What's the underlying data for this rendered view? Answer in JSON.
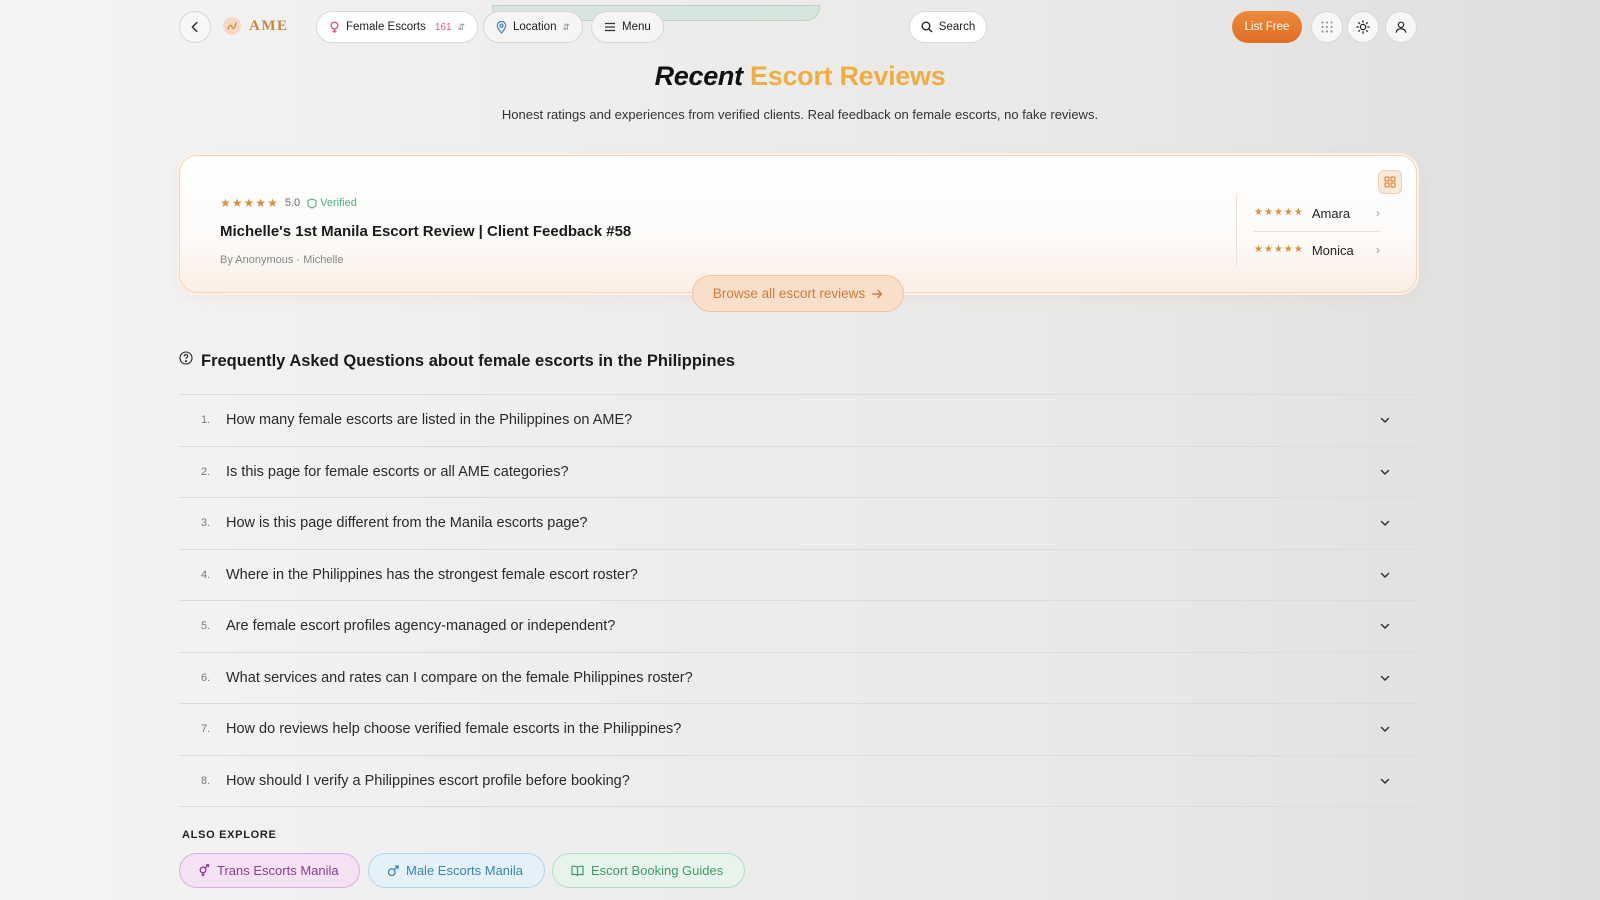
{
  "header": {
    "logo_text": "AME",
    "category_pill": {
      "label": "Female Escorts",
      "count": "161"
    },
    "location_pill": {
      "label": "Location"
    },
    "menu_pill": {
      "label": "Menu"
    },
    "search_label": "Search",
    "list_free_label": "List Free"
  },
  "hero": {
    "title_a": "Recent",
    "title_b": "Escort Reviews",
    "subtitle": "Honest ratings and experiences from verified clients. Real feedback on female escorts, no fake reviews."
  },
  "review_card": {
    "stars": 5,
    "rating": "5.0",
    "verified_label": "Verified",
    "title": "Michelle's 1st Manila Escort Review | Client Feedback #58",
    "byline": "By Anonymous · Michelle",
    "side_reviews": [
      {
        "name": "Amara",
        "stars": 5
      },
      {
        "name": "Monica",
        "stars": 5
      }
    ],
    "browse_label": "Browse all escort reviews"
  },
  "faq": {
    "heading": "Frequently Asked Questions about female escorts in the Philippines",
    "items": [
      {
        "num": "1.",
        "q": "How many female escorts are listed in the Philippines on AME?"
      },
      {
        "num": "2.",
        "q": "Is this page for female escorts or all AME categories?"
      },
      {
        "num": "3.",
        "q": "How is this page different from the Manila escorts page?"
      },
      {
        "num": "4.",
        "q": "Where in the Philippines has the strongest female escort roster?"
      },
      {
        "num": "5.",
        "q": "Are female escort profiles agency-managed or independent?"
      },
      {
        "num": "6.",
        "q": "What services and rates can I compare on the female Philippines roster?"
      },
      {
        "num": "7.",
        "q": "How do reviews help choose verified female escorts in the Philippines?"
      },
      {
        "num": "8.",
        "q": "How should I verify a Philippines escort profile before booking?"
      }
    ]
  },
  "also_explore": {
    "heading": "ALSO EXPLORE",
    "chips": [
      {
        "label": "Trans Escorts Manila",
        "icon": "transgender-icon"
      },
      {
        "label": "Male Escorts Manila",
        "icon": "male-icon"
      },
      {
        "label": "Escort Booking Guides",
        "icon": "book-icon"
      }
    ]
  },
  "colors": {
    "accent_orange": "#e07a2e",
    "title_gold": "#efae45",
    "verified_green": "#46b37e",
    "count_pink": "#e0578a"
  }
}
